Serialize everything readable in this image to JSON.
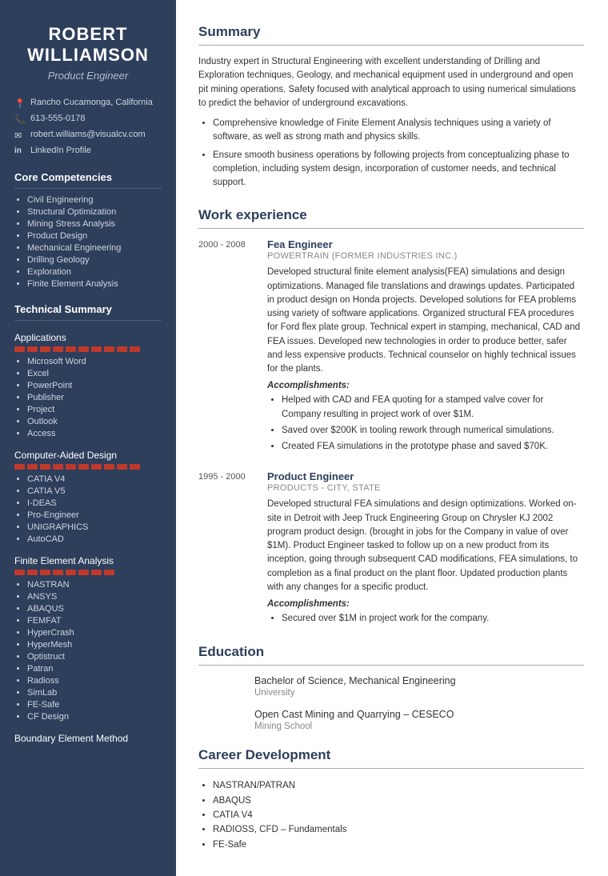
{
  "sidebar": {
    "name_line1": "ROBERT",
    "name_line2": "WILLIAMSON",
    "job_title": "Product Engineer",
    "contact": [
      {
        "icon": "📍",
        "text": "Rancho Cucamonga, California",
        "name": "location"
      },
      {
        "icon": "📞",
        "text": "613-555-0178",
        "name": "phone"
      },
      {
        "icon": "✉",
        "text": "robert.williams@visualcv.com",
        "name": "email"
      },
      {
        "icon": "in",
        "text": "LinkedIn Profile",
        "name": "linkedin"
      }
    ],
    "competencies_title": "Core Competencies",
    "competencies": [
      "Civil Engineering",
      "Structural Optimization",
      "Mining Stress Analysis",
      "Product Design",
      "Mechanical Engineering",
      "Drilling Geology",
      "Exploration",
      "Finite Element Analysis"
    ],
    "tech_summary_title": "Technical Summary",
    "applications_title": "Applications",
    "applications_bar_count": 10,
    "applications": [
      "Microsoft Word",
      "Excel",
      "PowerPoint",
      "Publisher",
      "Project",
      "Outlook",
      "Access"
    ],
    "cad_title": "Computer-Aided Design",
    "cad_bar_count": 10,
    "cad": [
      "CATIA V4",
      "CATIA V5",
      "I-DEAS",
      "Pro-Engineer",
      "UNIGRAPHICS",
      "AutoCAD"
    ],
    "fea_title": "Finite Element Analysis",
    "fea_bar_count": 8,
    "fea": [
      "NASTRAN",
      "ANSYS",
      "ABAQUS",
      "FEMFAT",
      "HyperCrash",
      "HyperMesh",
      "Optistruct",
      "Patran",
      "Radioss",
      "SimLab",
      "FE-Safe",
      "CF Design"
    ],
    "bem_title": "Boundary Element Method"
  },
  "main": {
    "summary_title": "Summary",
    "summary_text": "Industry expert in Structural Engineering with excellent understanding of Drilling and Exploration techniques, Geology, and mechanical equipment used in underground and open pit mining operations. Safety focused with analytical approach to using numerical simulations to predict the behavior of underground excavations.",
    "summary_bullets": [
      "Comprehensive knowledge of Finite Element Analysis techniques using a variety of software, as well as strong math and physics skills.",
      "Ensure smooth business operations by following projects from conceptualizing phase to completion, including system design, incorporation of customer needs, and technical support."
    ],
    "work_title": "Work experience",
    "jobs": [
      {
        "dates": "2000 - 2008",
        "job_title": "Fea Engineer",
        "company": "POWERTRAIN (FORMER INDUSTRIES INC.)",
        "description": "Developed structural finite element analysis(FEA) simulations and design optimizations. Managed file translations and drawings updates. Participated in product design on Honda projects. Developed solutions for FEA problems using variety of software applications. Organized structural FEA procedures for Ford flex plate group. Technical expert in stamping, mechanical, CAD and FEA issues. Developed new technologies in order to produce better, safer and less expensive products. Technical counselor on highly technical issues for the plants.",
        "accomplishments_label": "Accomplishments:",
        "accomplishments": [
          "Helped with CAD and FEA quoting for a stamped valve cover for Company resulting in project work of over $1M.",
          "Saved over $200K in tooling rework through numerical simulations.",
          "Created FEA simulations in the prototype phase and saved $70K."
        ]
      },
      {
        "dates": "1995 - 2000",
        "job_title": "Product Engineer",
        "company": "PRODUCTS - CITY, STATE",
        "description": "Developed structural FEA simulations and design optimizations. Worked on-site in Detroit with Jeep Truck Engineering Group on Chrysler KJ 2002 program product design. (brought in jobs for the Company in value of over $1M). Product Engineer tasked to follow up on a new product from its inception, going through subsequent CAD modifications, FEA simulations, to completion as a final product on the plant floor. Updated production plants with any changes for a specific product.",
        "accomplishments_label": "Accomplishments:",
        "accomplishments": [
          "Secured over $1M in project work for the company."
        ]
      }
    ],
    "education_title": "Education",
    "education": [
      {
        "degree": "Bachelor of Science, Mechanical Engineering",
        "school": "University"
      },
      {
        "degree": "Open Cast Mining and Quarrying – CESECO",
        "school": "Mining School"
      }
    ],
    "career_title": "Career Development",
    "career_items": [
      "NASTRAN/PATRAN",
      "ABAQUS",
      "CATIA V4",
      "RADIOSS, CFD – Fundamentals",
      "FE-Safe"
    ]
  }
}
